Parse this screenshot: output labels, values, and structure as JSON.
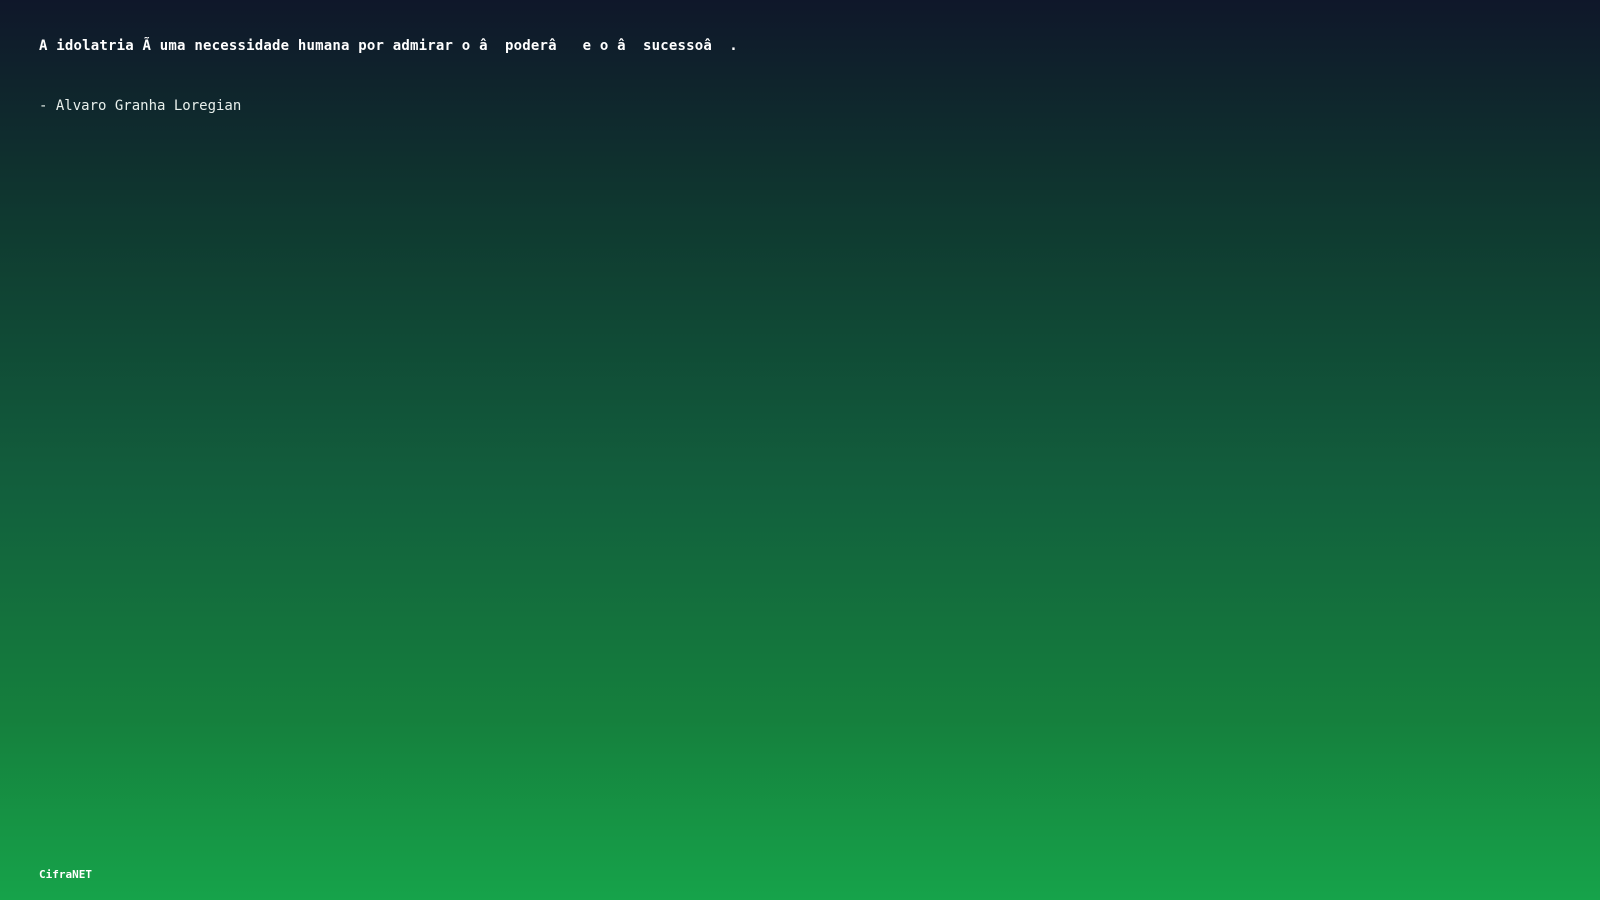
{
  "quote": {
    "text": "A idolatria Ã uma necessidade humana por admirar o â  poderâ   e o â  sucessoâ  .",
    "author": "- Alvaro Granha Loregian"
  },
  "brand": {
    "name": "CifraNET"
  }
}
